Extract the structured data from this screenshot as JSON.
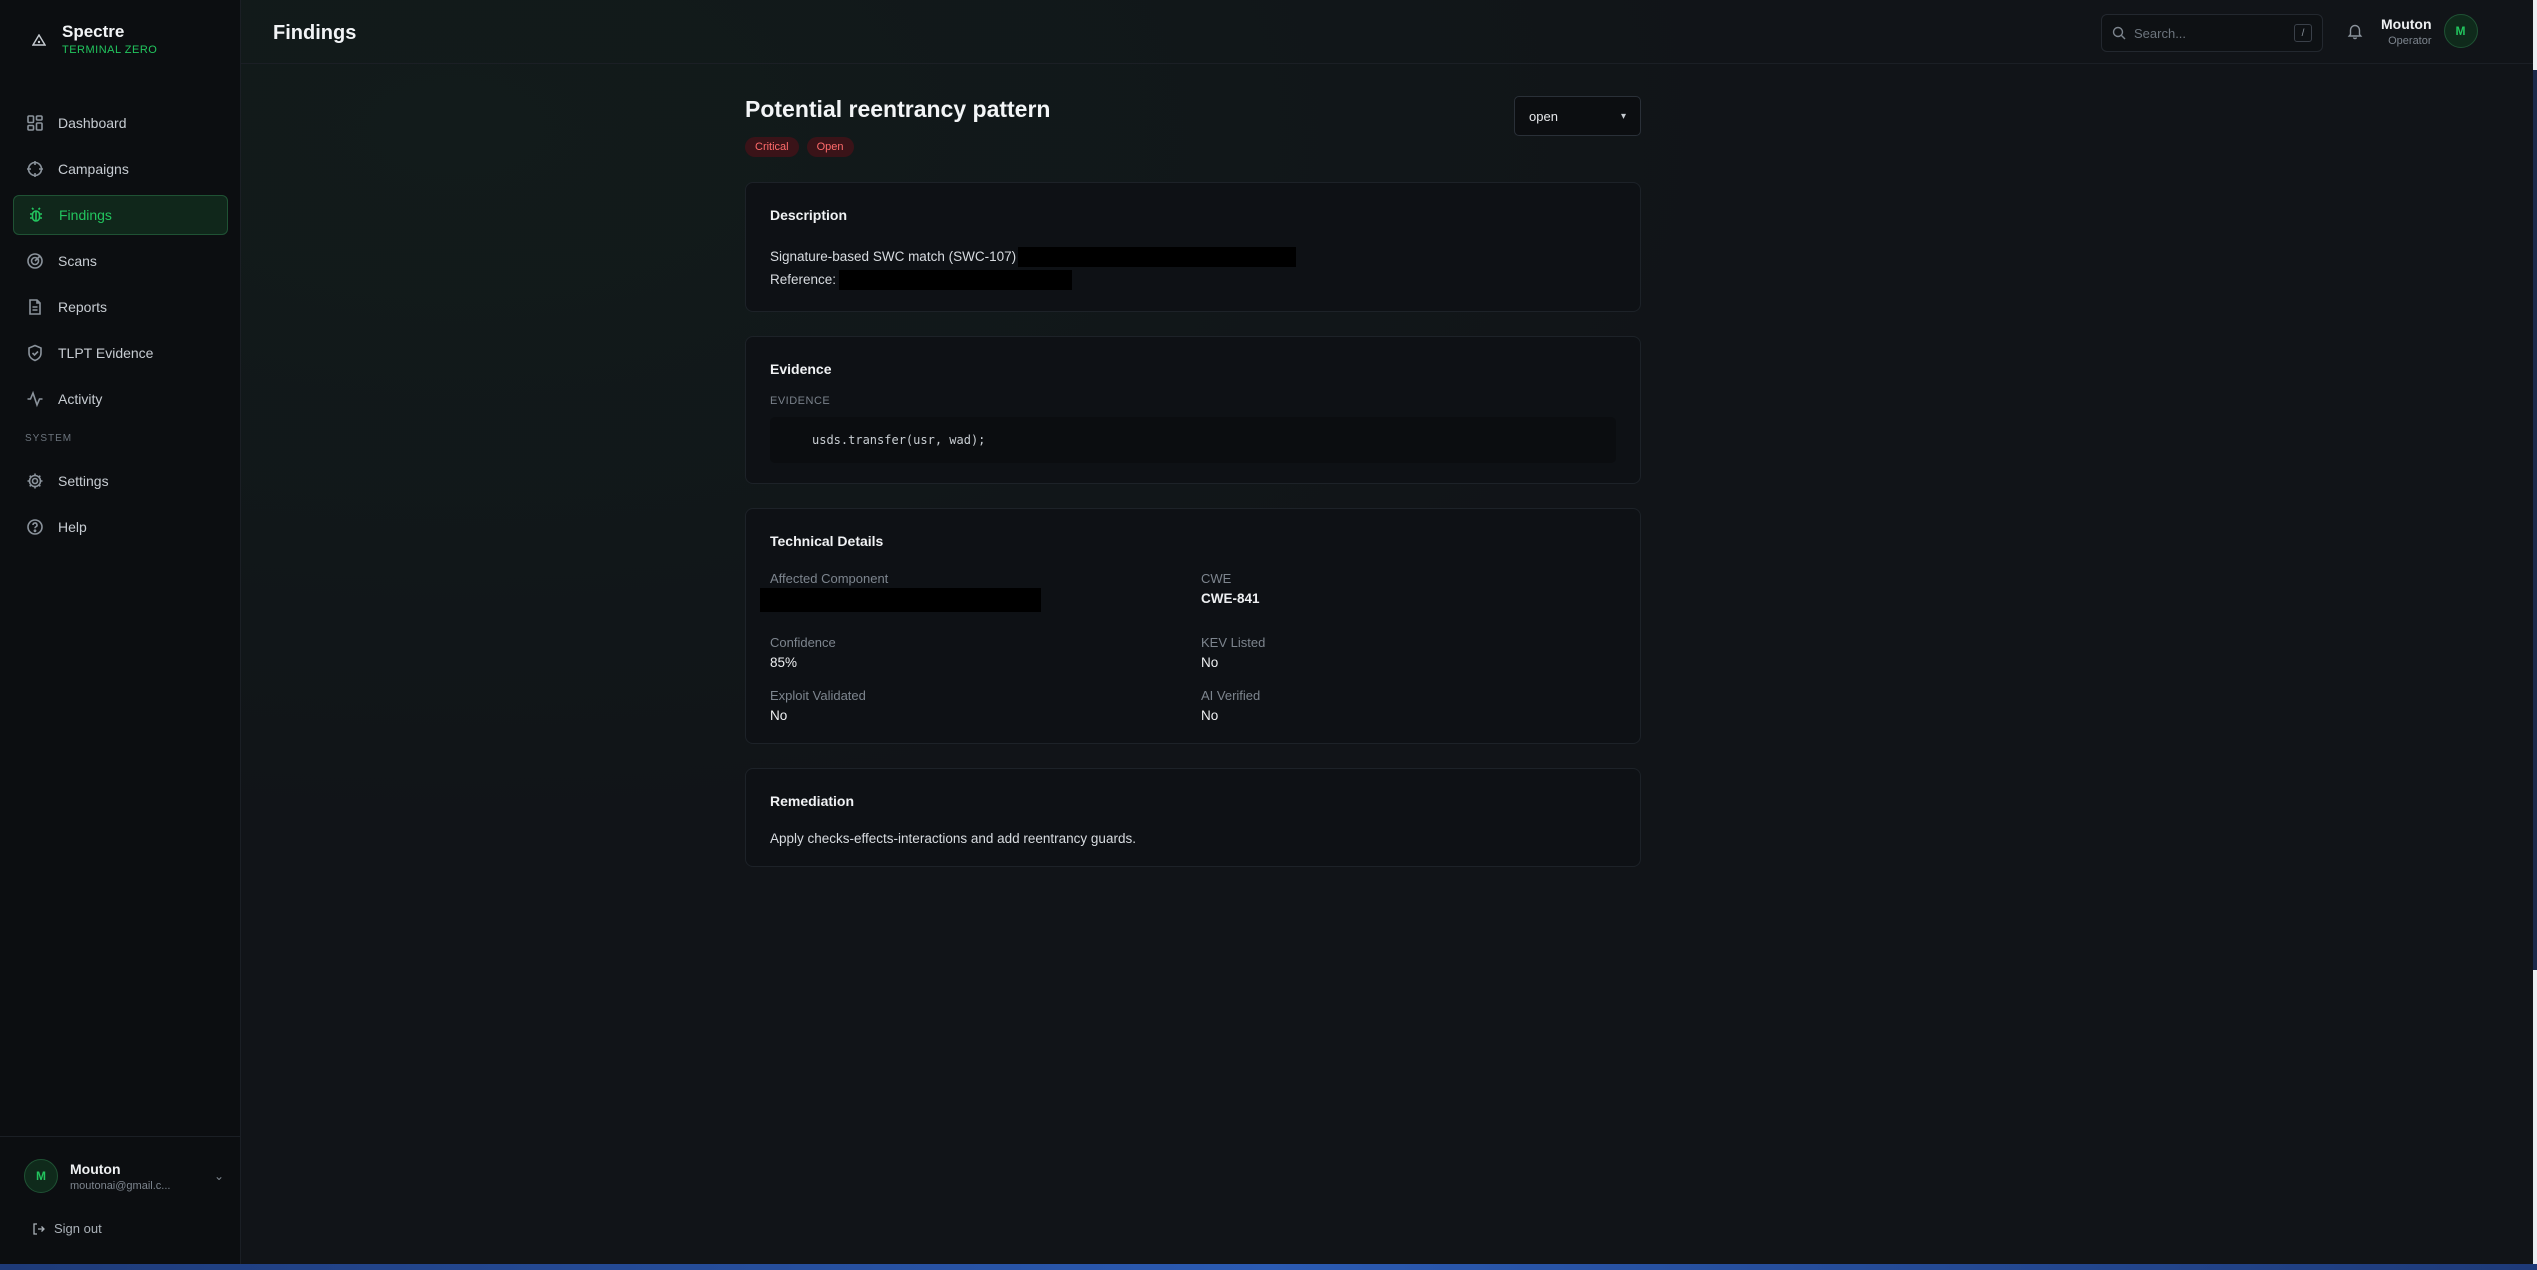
{
  "brand": {
    "name": "Spectre",
    "subtitle": "TERMINAL ZERO"
  },
  "sidebar": {
    "items": [
      {
        "label": "Dashboard",
        "icon": "grid-icon"
      },
      {
        "label": "Campaigns",
        "icon": "crosshair-icon"
      },
      {
        "label": "Findings",
        "icon": "bug-icon",
        "active": true
      },
      {
        "label": "Scans",
        "icon": "radar-icon"
      },
      {
        "label": "Reports",
        "icon": "document-icon"
      },
      {
        "label": "TLPT Evidence",
        "icon": "shield-icon"
      },
      {
        "label": "Activity",
        "icon": "activity-icon"
      }
    ],
    "section_label": "SYSTEM",
    "system_items": [
      {
        "label": "Settings",
        "icon": "gear-icon"
      },
      {
        "label": "Help",
        "icon": "help-icon"
      }
    ],
    "user": {
      "initial": "M",
      "name": "Mouton",
      "email": "moutonai@gmail.c..."
    },
    "signout_label": "Sign out"
  },
  "header": {
    "title": "Findings",
    "search_placeholder": "Search...",
    "search_shortcut": "/",
    "user": {
      "name": "Mouton",
      "role": "Operator",
      "initial": "M"
    }
  },
  "finding": {
    "title": "Potential reentrancy pattern",
    "severity": "Critical",
    "status_badge": "Open",
    "status_select": "open",
    "description": {
      "heading": "Description",
      "line1": "Signature-based SWC match (SWC-107)",
      "line2_label": "Reference:"
    },
    "evidence": {
      "heading": "Evidence",
      "label": "EVIDENCE",
      "code": "usds.transfer(usr, wad);"
    },
    "technical": {
      "heading": "Technical Details",
      "affected_component_label": "Affected Component",
      "cwe_label": "CWE",
      "cwe_value": "CWE-841",
      "confidence_label": "Confidence",
      "confidence_value": "85%",
      "kev_label": "KEV Listed",
      "kev_value": "No",
      "exploit_label": "Exploit Validated",
      "exploit_value": "No",
      "ai_label": "AI Verified",
      "ai_value": "No"
    },
    "remediation": {
      "heading": "Remediation",
      "text": "Apply checks-effects-interactions and add reentrancy guards."
    }
  },
  "colors": {
    "accent": "#22c55e",
    "critical": "#ff6b6b",
    "critical_bg": "#3a1318"
  }
}
